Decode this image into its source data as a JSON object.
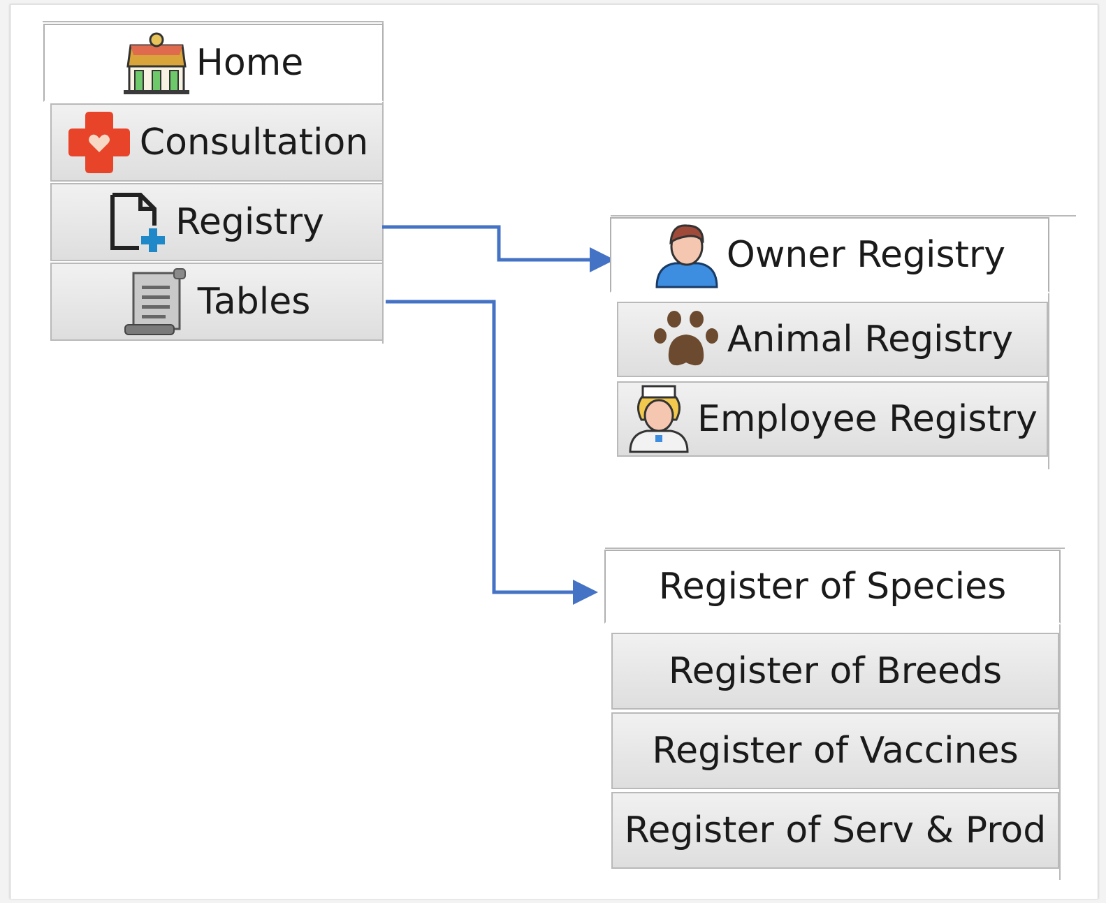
{
  "main_menu": {
    "home": {
      "label": "Home",
      "icon": "clinic-building-icon"
    },
    "consultation": {
      "label": "Consultation",
      "icon": "red-cross-icon"
    },
    "registry": {
      "label": "Registry",
      "icon": "document-add-icon"
    },
    "tables": {
      "label": "Tables",
      "icon": "scroll-icon"
    }
  },
  "registry_submenu": {
    "owner": {
      "label": "Owner Registry",
      "icon": "user-icon"
    },
    "animal": {
      "label": "Animal Registry",
      "icon": "paw-icon"
    },
    "employee": {
      "label": "Employee Registry",
      "icon": "nurse-icon"
    }
  },
  "tables_submenu": {
    "species": {
      "label": "Register of Species"
    },
    "breeds": {
      "label": "Register of Breeds"
    },
    "vaccines": {
      "label": "Register of Vaccines"
    },
    "serv_prod": {
      "label": "Register of Serv & Prod"
    }
  },
  "colors": {
    "arrow": "#4472c4",
    "cross": "#e8442a",
    "tab_border": "#b9b9b9"
  }
}
